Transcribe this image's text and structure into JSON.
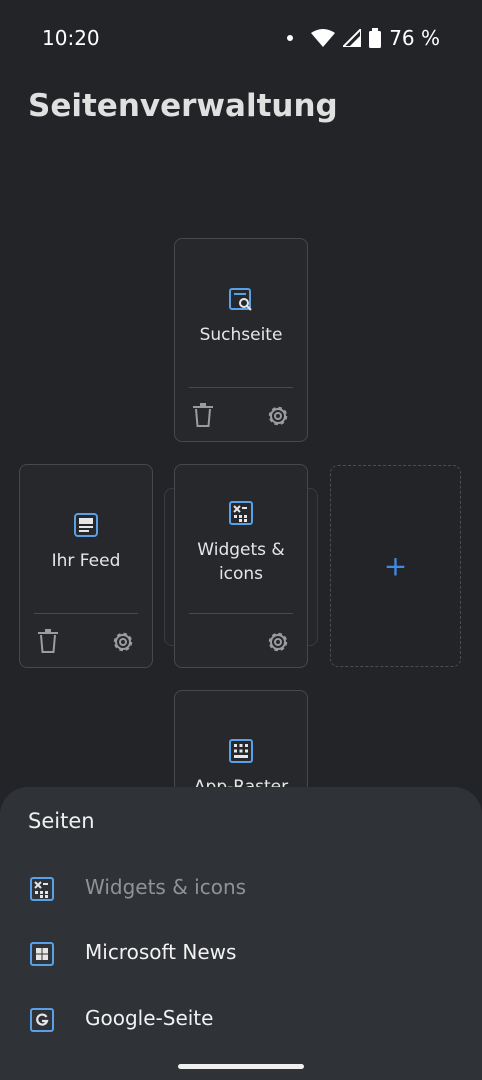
{
  "status_bar": {
    "time": "10:20",
    "battery": "76 %"
  },
  "page_title": "Seitenverwaltung",
  "cards": {
    "search": {
      "label": "Suchseite"
    },
    "feed": {
      "label": "Ihr Feed"
    },
    "widgets": {
      "label_line1": "Widgets &",
      "label_line2": "icons"
    },
    "apps": {
      "label": "App-Raster"
    },
    "add": {
      "symbol": "+"
    }
  },
  "sheet": {
    "title": "Seiten",
    "items": [
      {
        "label": "Widgets & icons",
        "icon": "widgets-icon",
        "enabled": false
      },
      {
        "label": "Microsoft News",
        "icon": "windows-icon",
        "enabled": true
      },
      {
        "label": "Google-Seite",
        "icon": "google-icon",
        "enabled": true
      }
    ]
  },
  "colors": {
    "background": "#222427",
    "card": "#26282c",
    "accent_blue": "#5aa0e6",
    "plus_blue": "#3f8be6",
    "sheet": "#2f3236"
  }
}
